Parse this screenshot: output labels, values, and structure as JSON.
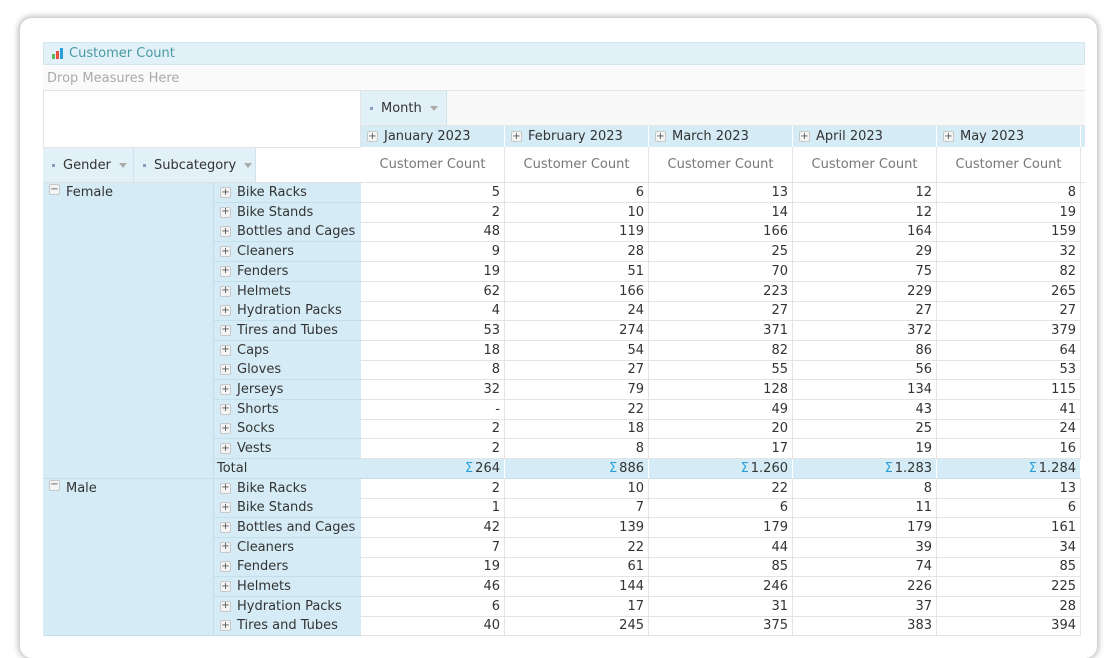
{
  "pivot": {
    "title": "Customer Count",
    "title_icon": "bar-chart-icon",
    "icon_colors": [
      "#5cb85c",
      "#e74c3c",
      "#2a9fd6"
    ],
    "drop_measures_placeholder": "Drop Measures Here",
    "column_field": "Month",
    "row_fields": [
      "Gender",
      "Subcategory"
    ],
    "measure": "Customer Count",
    "total_label": "Total",
    "sigma": "Σ",
    "months": [
      "January 2023",
      "February 2023",
      "March 2023",
      "April 2023",
      "May 2023"
    ],
    "groups": [
      {
        "gender": "Female",
        "expanded": true,
        "rows": [
          {
            "subcategory": "Bike Racks",
            "values": [
              "5",
              "6",
              "13",
              "12",
              "8"
            ]
          },
          {
            "subcategory": "Bike Stands",
            "values": [
              "2",
              "10",
              "14",
              "12",
              "19"
            ]
          },
          {
            "subcategory": "Bottles and Cages",
            "values": [
              "48",
              "119",
              "166",
              "164",
              "159"
            ]
          },
          {
            "subcategory": "Cleaners",
            "values": [
              "9",
              "28",
              "25",
              "29",
              "32"
            ]
          },
          {
            "subcategory": "Fenders",
            "values": [
              "19",
              "51",
              "70",
              "75",
              "82"
            ]
          },
          {
            "subcategory": "Helmets",
            "values": [
              "62",
              "166",
              "223",
              "229",
              "265"
            ]
          },
          {
            "subcategory": "Hydration Packs",
            "values": [
              "4",
              "24",
              "27",
              "27",
              "27"
            ]
          },
          {
            "subcategory": "Tires and Tubes",
            "values": [
              "53",
              "274",
              "371",
              "372",
              "379"
            ]
          },
          {
            "subcategory": "Caps",
            "values": [
              "18",
              "54",
              "82",
              "86",
              "64"
            ]
          },
          {
            "subcategory": "Gloves",
            "values": [
              "8",
              "27",
              "55",
              "56",
              "53"
            ]
          },
          {
            "subcategory": "Jerseys",
            "values": [
              "32",
              "79",
              "128",
              "134",
              "115"
            ]
          },
          {
            "subcategory": "Shorts",
            "values": [
              "-",
              "22",
              "49",
              "43",
              "41"
            ]
          },
          {
            "subcategory": "Socks",
            "values": [
              "2",
              "18",
              "20",
              "25",
              "24"
            ]
          },
          {
            "subcategory": "Vests",
            "values": [
              "2",
              "8",
              "17",
              "19",
              "16"
            ]
          }
        ],
        "totals": [
          "264",
          "886",
          "1.260",
          "1.283",
          "1.284"
        ]
      },
      {
        "gender": "Male",
        "expanded": true,
        "rows": [
          {
            "subcategory": "Bike Racks",
            "values": [
              "2",
              "10",
              "22",
              "8",
              "13"
            ]
          },
          {
            "subcategory": "Bike Stands",
            "values": [
              "1",
              "7",
              "6",
              "11",
              "6"
            ]
          },
          {
            "subcategory": "Bottles and Cages",
            "values": [
              "42",
              "139",
              "179",
              "179",
              "161"
            ]
          },
          {
            "subcategory": "Cleaners",
            "values": [
              "7",
              "22",
              "44",
              "39",
              "34"
            ]
          },
          {
            "subcategory": "Fenders",
            "values": [
              "19",
              "61",
              "85",
              "74",
              "85"
            ]
          },
          {
            "subcategory": "Helmets",
            "values": [
              "46",
              "144",
              "246",
              "226",
              "225"
            ]
          },
          {
            "subcategory": "Hydration Packs",
            "values": [
              "6",
              "17",
              "31",
              "37",
              "28"
            ]
          },
          {
            "subcategory": "Tires and Tubes",
            "values": [
              "40",
              "245",
              "375",
              "383",
              "394"
            ]
          }
        ]
      }
    ]
  }
}
